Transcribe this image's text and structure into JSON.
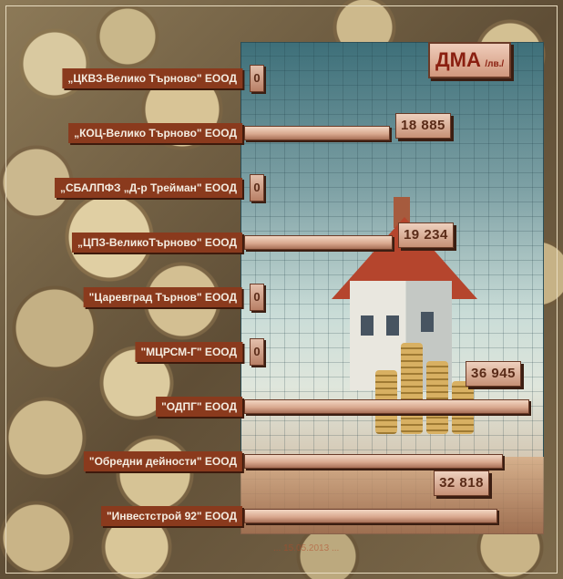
{
  "chart_data": {
    "type": "bar",
    "orientation": "horizontal",
    "title": "ДМА",
    "unit": "/лв./",
    "categories": [
      "„ЦКВЗ-Велико Търново\" ЕООД",
      "„КОЦ-Велико Търново\" ЕООД",
      "„СБАЛПФЗ „Д-р Трейман\" ЕООД",
      "„ЦПЗ-ВеликоТърново\" ЕООД",
      "\"Царевград Търнов\" ЕООД",
      "\"МЦРСМ-Г\" ЕООД",
      "\"ОДПГ\" ЕООД",
      "\"Обредни дейности\" ЕООД",
      "\"Инвестстрой 92\" ЕООД"
    ],
    "values": [
      0,
      18885,
      0,
      19234,
      0,
      0,
      36945,
      33500,
      32818
    ],
    "value_labels": [
      "0",
      "18 885",
      "0",
      "19 234",
      "0",
      "0",
      "36 945",
      "",
      "32 818"
    ],
    "xlim": [
      0,
      38000
    ],
    "grid": true,
    "legend": "none"
  },
  "footer_note": "... 15.05.2013 ..."
}
